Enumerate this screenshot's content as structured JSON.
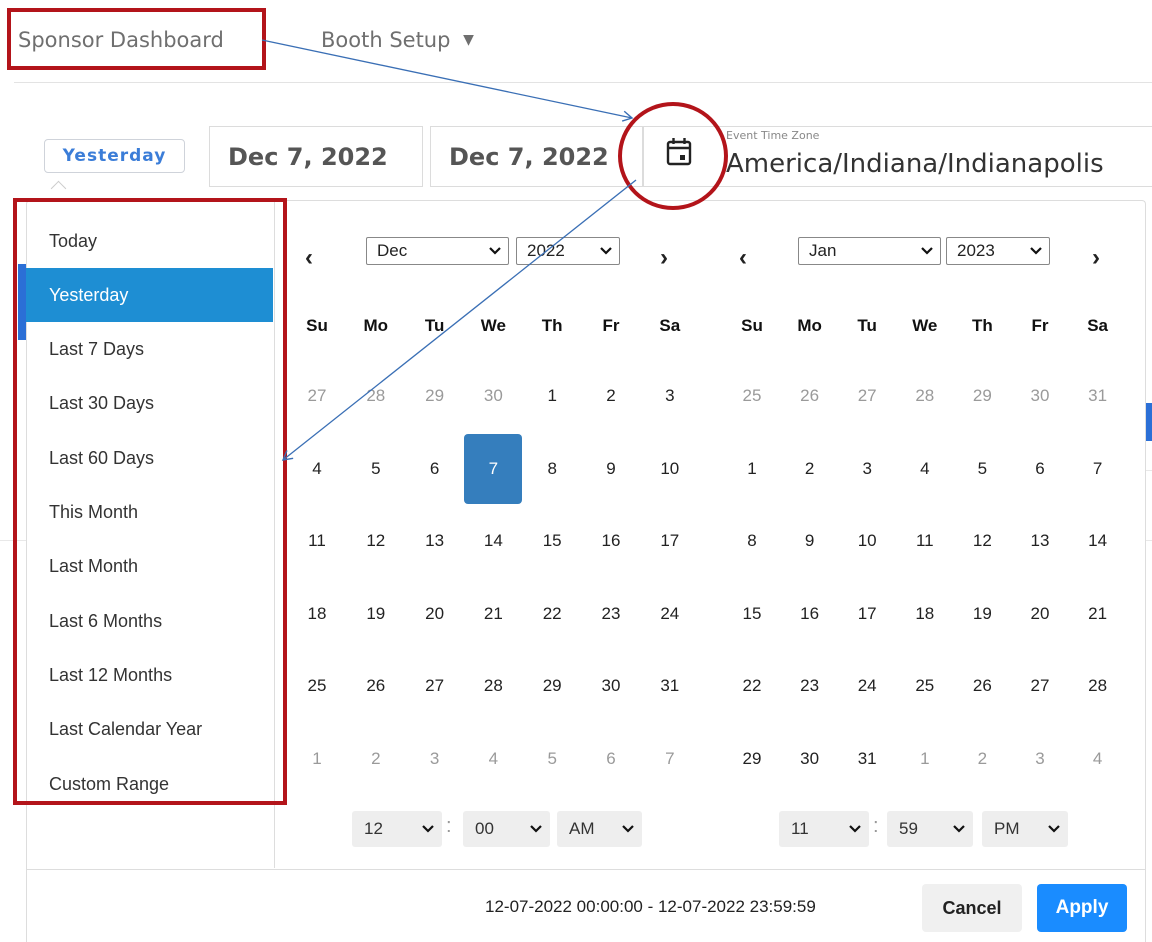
{
  "nav": {
    "sponsor_dashboard": "Sponsor Dashboard",
    "booth_setup": "Booth Setup",
    "booth_setup_caret": "▼"
  },
  "header": {
    "range_badge": "Yesterday",
    "start_date": "Dec 7, 2022",
    "end_date": "Dec 7, 2022",
    "timezone_label": "Event Time Zone",
    "timezone_value": "America/Indiana/Indianapolis"
  },
  "ranges": [
    "Today",
    "Yesterday",
    "Last 7 Days",
    "Last 30 Days",
    "Last 60 Days",
    "This Month",
    "Last Month",
    "Last 6 Months",
    "Last 12 Months",
    "Last Calendar Year",
    "Custom Range"
  ],
  "active_range": "Yesterday",
  "weekdays": [
    "Su",
    "Mo",
    "Tu",
    "We",
    "Th",
    "Fr",
    "Sa"
  ],
  "left_calendar": {
    "prev": "‹",
    "next": "›",
    "month": "Dec",
    "year": "2022",
    "weeks": [
      [
        [
          "27",
          0
        ],
        [
          "28",
          0
        ],
        [
          "29",
          0
        ],
        [
          "30",
          0
        ],
        [
          "1",
          1
        ],
        [
          "2",
          1
        ],
        [
          "3",
          1
        ]
      ],
      [
        [
          "4",
          1
        ],
        [
          "5",
          1
        ],
        [
          "6",
          1
        ],
        [
          "7",
          2
        ],
        [
          "8",
          1
        ],
        [
          "9",
          1
        ],
        [
          "10",
          1
        ]
      ],
      [
        [
          "11",
          1
        ],
        [
          "12",
          1
        ],
        [
          "13",
          1
        ],
        [
          "14",
          1
        ],
        [
          "15",
          1
        ],
        [
          "16",
          1
        ],
        [
          "17",
          1
        ]
      ],
      [
        [
          "18",
          1
        ],
        [
          "19",
          1
        ],
        [
          "20",
          1
        ],
        [
          "21",
          1
        ],
        [
          "22",
          1
        ],
        [
          "23",
          1
        ],
        [
          "24",
          1
        ]
      ],
      [
        [
          "25",
          1
        ],
        [
          "26",
          1
        ],
        [
          "27",
          1
        ],
        [
          "28",
          1
        ],
        [
          "29",
          1
        ],
        [
          "30",
          1
        ],
        [
          "31",
          1
        ]
      ],
      [
        [
          "1",
          0
        ],
        [
          "2",
          0
        ],
        [
          "3",
          0
        ],
        [
          "4",
          0
        ],
        [
          "5",
          0
        ],
        [
          "6",
          0
        ],
        [
          "7",
          0
        ]
      ]
    ],
    "time": {
      "hour": "12",
      "minute": "00",
      "ampm": "AM"
    }
  },
  "right_calendar": {
    "prev": "‹",
    "next": "›",
    "month": "Jan",
    "year": "2023",
    "weeks": [
      [
        [
          "25",
          0
        ],
        [
          "26",
          0
        ],
        [
          "27",
          0
        ],
        [
          "28",
          0
        ],
        [
          "29",
          0
        ],
        [
          "30",
          0
        ],
        [
          "31",
          0
        ]
      ],
      [
        [
          "1",
          1
        ],
        [
          "2",
          1
        ],
        [
          "3",
          1
        ],
        [
          "4",
          1
        ],
        [
          "5",
          1
        ],
        [
          "6",
          1
        ],
        [
          "7",
          1
        ]
      ],
      [
        [
          "8",
          1
        ],
        [
          "9",
          1
        ],
        [
          "10",
          1
        ],
        [
          "11",
          1
        ],
        [
          "12",
          1
        ],
        [
          "13",
          1
        ],
        [
          "14",
          1
        ]
      ],
      [
        [
          "15",
          1
        ],
        [
          "16",
          1
        ],
        [
          "17",
          1
        ],
        [
          "18",
          1
        ],
        [
          "19",
          1
        ],
        [
          "20",
          1
        ],
        [
          "21",
          1
        ]
      ],
      [
        [
          "22",
          1
        ],
        [
          "23",
          1
        ],
        [
          "24",
          1
        ],
        [
          "25",
          1
        ],
        [
          "26",
          1
        ],
        [
          "27",
          1
        ],
        [
          "28",
          1
        ]
      ],
      [
        [
          "29",
          1
        ],
        [
          "30",
          1
        ],
        [
          "31",
          1
        ],
        [
          "1",
          0
        ],
        [
          "2",
          0
        ],
        [
          "3",
          0
        ],
        [
          "4",
          0
        ]
      ]
    ],
    "time": {
      "hour": "11",
      "minute": "59",
      "ampm": "PM"
    }
  },
  "time_separator": ":",
  "footer": {
    "selected_range": "12-07-2022 00:00:00 - 12-07-2022 23:59:59",
    "cancel": "Cancel",
    "apply": "Apply"
  },
  "colors": {
    "accent": "#1e8ed3",
    "selected_day": "#357ebd",
    "apply": "#1a8cff",
    "annotation": "#b3141a",
    "arrow": "#3a6fb5"
  }
}
